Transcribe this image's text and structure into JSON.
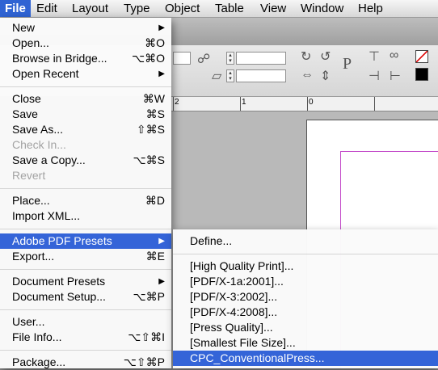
{
  "menubar": {
    "items": [
      "File",
      "Edit",
      "Layout",
      "Type",
      "Object",
      "Table",
      "View",
      "Window",
      "Help"
    ]
  },
  "ruler": {
    "labels": [
      "2",
      "1",
      "0"
    ]
  },
  "file_menu": {
    "items": [
      {
        "label": "New",
        "submenu": true
      },
      {
        "label": "Open...",
        "shortcut": "⌘O"
      },
      {
        "label": "Browse in Bridge...",
        "shortcut": "⌥⌘O"
      },
      {
        "label": "Open Recent",
        "submenu": true
      },
      {
        "label": "Close",
        "shortcut": "⌘W"
      },
      {
        "label": "Save",
        "shortcut": "⌘S"
      },
      {
        "label": "Save As...",
        "shortcut": "⇧⌘S"
      },
      {
        "label": "Check In...",
        "disabled": true
      },
      {
        "label": "Save a Copy...",
        "shortcut": "⌥⌘S"
      },
      {
        "label": "Revert",
        "disabled": true
      },
      {
        "label": "Place...",
        "shortcut": "⌘D"
      },
      {
        "label": "Import XML..."
      },
      {
        "label": "Adobe PDF Presets",
        "submenu": true,
        "highlighted": true
      },
      {
        "label": "Export...",
        "shortcut": "⌘E"
      },
      {
        "label": "Document Presets",
        "submenu": true
      },
      {
        "label": "Document Setup...",
        "shortcut": "⌥⌘P"
      },
      {
        "label": "User..."
      },
      {
        "label": "File Info...",
        "shortcut": "⌥⇧⌘I"
      },
      {
        "label": "Package...",
        "shortcut": "⌥⇧⌘P"
      }
    ]
  },
  "pdf_presets_menu": {
    "items": [
      {
        "label": "Define..."
      },
      {
        "label": "[High Quality Print]..."
      },
      {
        "label": "[PDF/X-1a:2001]..."
      },
      {
        "label": "[PDF/X-3:2002]..."
      },
      {
        "label": "[PDF/X-4:2008]..."
      },
      {
        "label": "[Press Quality]..."
      },
      {
        "label": "[Smallest File Size]..."
      },
      {
        "label": "CPC_ConventionalPress...",
        "highlighted": true
      }
    ]
  },
  "colors": {
    "highlight": "#3464d8",
    "menu_bg": "#fafafa",
    "margin_guide": "#c34ac9"
  }
}
